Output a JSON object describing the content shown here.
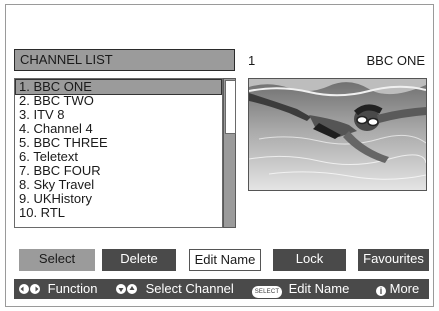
{
  "header": {
    "title": "CHANNEL LIST",
    "current_number": "1",
    "current_name": "BBC ONE"
  },
  "channels": [
    "1. BBC ONE",
    "2. BBC TWO",
    "3. ITV 8",
    "4. Channel 4",
    "5. BBC THREE",
    "6. Teletext",
    "7. BBC FOUR",
    "8. Sky Travel",
    "9. UKHistory",
    "10. RTL"
  ],
  "selected_index": 0,
  "scroll_position": 0.0,
  "buttons": {
    "select": "Select",
    "delete": "Delete",
    "edit_name": "Edit Name",
    "lock": "Lock",
    "favourites": "Favourites"
  },
  "help": {
    "function": "Function",
    "select_channel": "Select Channel",
    "select_badge": "SELECT",
    "edit_name": "Edit Name",
    "more": "More",
    "info_glyph": "i"
  },
  "icons": {
    "left_right": "left-right-arrows-icon",
    "up_down": "up-down-arrows-icon",
    "select_button": "select-button-icon",
    "info": "info-icon"
  },
  "colors": {
    "highlight": "#9b9b9b",
    "dark_button": "#4a4a4a",
    "help_bar": "#4a4a4a"
  }
}
